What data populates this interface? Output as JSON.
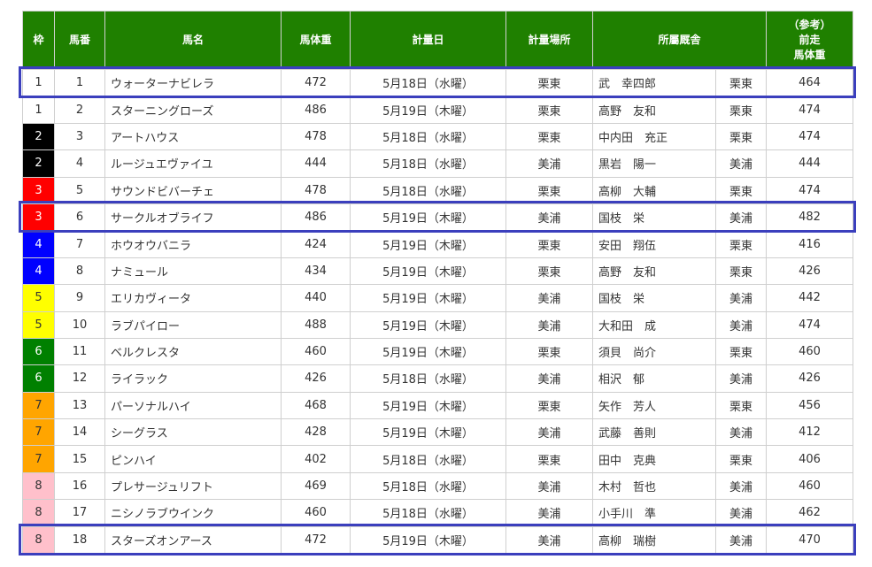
{
  "headers": {
    "waku": "枠",
    "umaban": "馬番",
    "name": "馬名",
    "weight": "馬体重",
    "date": "計量日",
    "place": "計量場所",
    "stable": "所屬厩舎",
    "prev_line1": "（参考）",
    "prev_line2": "前走",
    "prev_line3": "馬体重"
  },
  "waku_colors": {
    "1": "#ffffff",
    "2": "#000000",
    "3": "#ff0000",
    "4": "#0000ff",
    "5": "#ffff00",
    "6": "#008000",
    "7": "#ffa500",
    "8": "#ffc0cb"
  },
  "waku_text_colors": {
    "1": "#333333",
    "2": "#ffffff",
    "3": "#ffffff",
    "4": "#ffffff",
    "5": "#333333",
    "6": "#ffffff",
    "7": "#333333",
    "8": "#333333"
  },
  "highlight_color": "#3b3fbd",
  "highlighted_umaban": [
    1,
    6,
    18
  ],
  "rows": [
    {
      "waku": "1",
      "umaban": "1",
      "name": "ウォーターナビレラ",
      "weight": "472",
      "date": "5月18日（水曜）",
      "place": "栗東",
      "trainer": "武　幸四郎",
      "stable": "栗東",
      "prev": "464"
    },
    {
      "waku": "1",
      "umaban": "2",
      "name": "スターニングローズ",
      "weight": "486",
      "date": "5月19日（木曜）",
      "place": "栗東",
      "trainer": "高野　友和",
      "stable": "栗東",
      "prev": "474"
    },
    {
      "waku": "2",
      "umaban": "3",
      "name": "アートハウス",
      "weight": "478",
      "date": "5月18日（水曜）",
      "place": "栗東",
      "trainer": "中内田　充正",
      "stable": "栗東",
      "prev": "474"
    },
    {
      "waku": "2",
      "umaban": "4",
      "name": "ルージュエヴァイユ",
      "weight": "444",
      "date": "5月18日（水曜）",
      "place": "美浦",
      "trainer": "黒岩　陽一",
      "stable": "美浦",
      "prev": "444"
    },
    {
      "waku": "3",
      "umaban": "5",
      "name": "サウンドビバーチェ",
      "weight": "478",
      "date": "5月18日（水曜）",
      "place": "栗東",
      "trainer": "高柳　大輔",
      "stable": "栗東",
      "prev": "474"
    },
    {
      "waku": "3",
      "umaban": "6",
      "name": "サークルオブライフ",
      "weight": "486",
      "date": "5月19日（木曜）",
      "place": "美浦",
      "trainer": "国枝　栄",
      "stable": "美浦",
      "prev": "482"
    },
    {
      "waku": "4",
      "umaban": "7",
      "name": "ホウオウバニラ",
      "weight": "424",
      "date": "5月19日（木曜）",
      "place": "栗東",
      "trainer": "安田　翔伍",
      "stable": "栗東",
      "prev": "416"
    },
    {
      "waku": "4",
      "umaban": "8",
      "name": "ナミュール",
      "weight": "434",
      "date": "5月19日（木曜）",
      "place": "栗東",
      "trainer": "高野　友和",
      "stable": "栗東",
      "prev": "426"
    },
    {
      "waku": "5",
      "umaban": "9",
      "name": "エリカヴィータ",
      "weight": "440",
      "date": "5月19日（木曜）",
      "place": "美浦",
      "trainer": "国枝　栄",
      "stable": "美浦",
      "prev": "442"
    },
    {
      "waku": "5",
      "umaban": "10",
      "name": "ラブパイロー",
      "weight": "488",
      "date": "5月19日（木曜）",
      "place": "美浦",
      "trainer": "大和田　成",
      "stable": "美浦",
      "prev": "474"
    },
    {
      "waku": "6",
      "umaban": "11",
      "name": "ベルクレスタ",
      "weight": "460",
      "date": "5月19日（木曜）",
      "place": "栗東",
      "trainer": "須貝　尚介",
      "stable": "栗東",
      "prev": "460"
    },
    {
      "waku": "6",
      "umaban": "12",
      "name": "ライラック",
      "weight": "426",
      "date": "5月18日（水曜）",
      "place": "美浦",
      "trainer": "相沢　郁",
      "stable": "美浦",
      "prev": "426"
    },
    {
      "waku": "7",
      "umaban": "13",
      "name": "パーソナルハイ",
      "weight": "468",
      "date": "5月19日（木曜）",
      "place": "栗東",
      "trainer": "矢作　芳人",
      "stable": "栗東",
      "prev": "456"
    },
    {
      "waku": "7",
      "umaban": "14",
      "name": "シーグラス",
      "weight": "428",
      "date": "5月19日（木曜）",
      "place": "美浦",
      "trainer": "武藤　善則",
      "stable": "美浦",
      "prev": "412"
    },
    {
      "waku": "7",
      "umaban": "15",
      "name": "ピンハイ",
      "weight": "402",
      "date": "5月18日（水曜）",
      "place": "栗東",
      "trainer": "田中　克典",
      "stable": "栗東",
      "prev": "406"
    },
    {
      "waku": "8",
      "umaban": "16",
      "name": "プレサージュリフト",
      "weight": "469",
      "date": "5月18日（水曜）",
      "place": "美浦",
      "trainer": "木村　哲也",
      "stable": "美浦",
      "prev": "460"
    },
    {
      "waku": "8",
      "umaban": "17",
      "name": "ニシノラブウインク",
      "weight": "460",
      "date": "5月18日（水曜）",
      "place": "美浦",
      "trainer": "小手川　準",
      "stable": "美浦",
      "prev": "462"
    },
    {
      "waku": "8",
      "umaban": "18",
      "name": "スターズオンアース",
      "weight": "472",
      "date": "5月19日（木曜）",
      "place": "美浦",
      "trainer": "高柳　瑞樹",
      "stable": "美浦",
      "prev": "470"
    }
  ]
}
